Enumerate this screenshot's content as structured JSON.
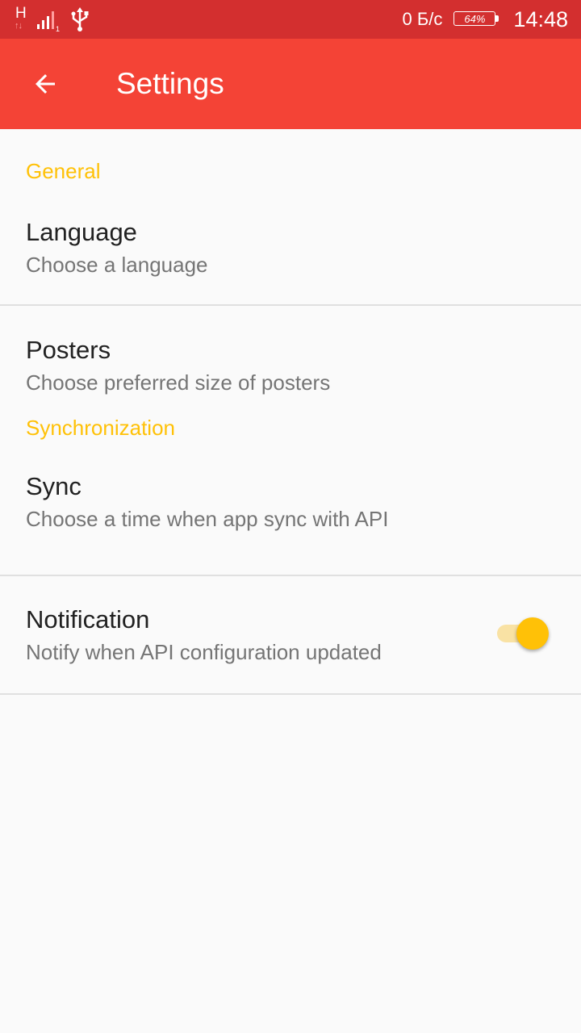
{
  "status_bar": {
    "network_type": "H",
    "network_arrows": "↑↓",
    "sim_slot": "1",
    "icons": [
      "signal-icon",
      "usb-icon"
    ],
    "net_speed": "0 Б/с",
    "battery": "64%",
    "time": "14:48"
  },
  "app_bar": {
    "back_icon": "arrow-back-icon",
    "title": "Settings"
  },
  "settings": {
    "general": {
      "category_title": "General",
      "language": {
        "title": "Language",
        "summary": "Choose a language"
      },
      "posters": {
        "title": "Posters",
        "summary": "Choose preferred size of posters"
      }
    },
    "synchronization": {
      "category_title": "Synchronization",
      "sync": {
        "title": "Sync",
        "summary": "Choose a time when app sync with API"
      },
      "notification": {
        "title": "Notification",
        "summary": "Notify when API configuration updated",
        "enabled": true
      }
    }
  },
  "colors": {
    "status_bar": "#d32f2f",
    "app_bar": "#f44336",
    "accent": "#ffc107",
    "background": "#fafafa"
  }
}
